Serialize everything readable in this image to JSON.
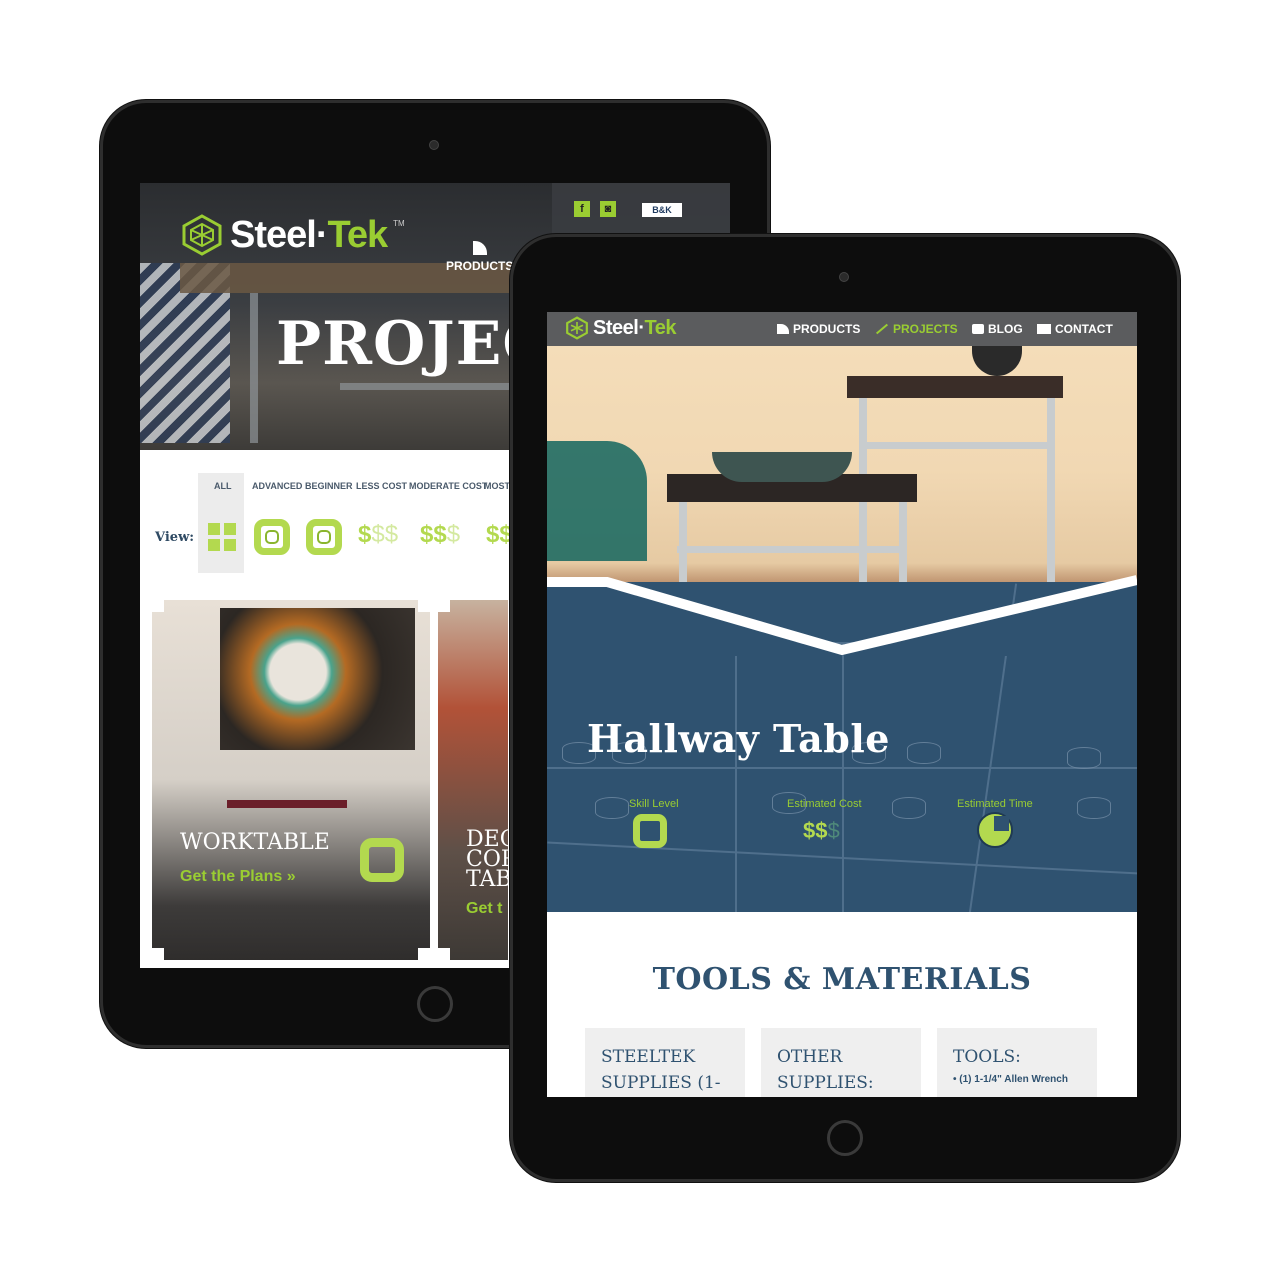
{
  "colors": {
    "brand_green": "#9acd32",
    "accent_lime": "#b3d94f",
    "navy": "#2f5270",
    "nav_gray": "#5b5c5e"
  },
  "back_tablet": {
    "logo": {
      "word_a": "Steel",
      "word_b": "Tek",
      "tm": "TM"
    },
    "social": {
      "facebook": "f",
      "instagram": "◙",
      "brand_badge": "B&K"
    },
    "nav_products": "PRODUCTS",
    "hero_title": "PROJEC",
    "filters": [
      "ALL",
      "ADVANCED",
      "BEGINNER",
      "LESS COST",
      "MODERATE COST",
      "MOST C"
    ],
    "view_label": "View:",
    "cost_icons": {
      "less": "$",
      "less_dim": "$$",
      "moderate": "$$",
      "moderate_dim": "$",
      "most": "$$"
    },
    "cards": [
      {
        "title": "WORKTABLE",
        "link": "Get the Plans »"
      },
      {
        "title_lines": [
          "DEC",
          "COR",
          "TAB"
        ],
        "link": "Get t"
      }
    ]
  },
  "front_tablet": {
    "logo": {
      "word_a": "Steel",
      "word_b": "Tek"
    },
    "nav": [
      {
        "label": "PRODUCTS",
        "icon": "pipe-icon",
        "active": false
      },
      {
        "label": "PROJECTS",
        "icon": "wrench-icon",
        "active": true
      },
      {
        "label": "BLOG",
        "icon": "speech-bubble-icon",
        "active": false
      },
      {
        "label": "CONTACT",
        "icon": "envelope-icon",
        "active": false
      }
    ],
    "project_title": "Hallway Table",
    "stats": {
      "skill_label": "Skill Level",
      "cost_label": "Estimated Cost",
      "cost_value": "$$",
      "cost_value_dim": "$",
      "time_label": "Estimated Time"
    },
    "tools_heading": "TOOLS & MATERIALS",
    "boxes": [
      {
        "heading": "STEELTEK SUPPLIES (1-",
        "item": ""
      },
      {
        "heading": "OTHER SUPPLIES:",
        "item": ""
      },
      {
        "heading": "TOOLS:",
        "item": "(1) 1-1/4\" Allen Wrench"
      }
    ]
  }
}
